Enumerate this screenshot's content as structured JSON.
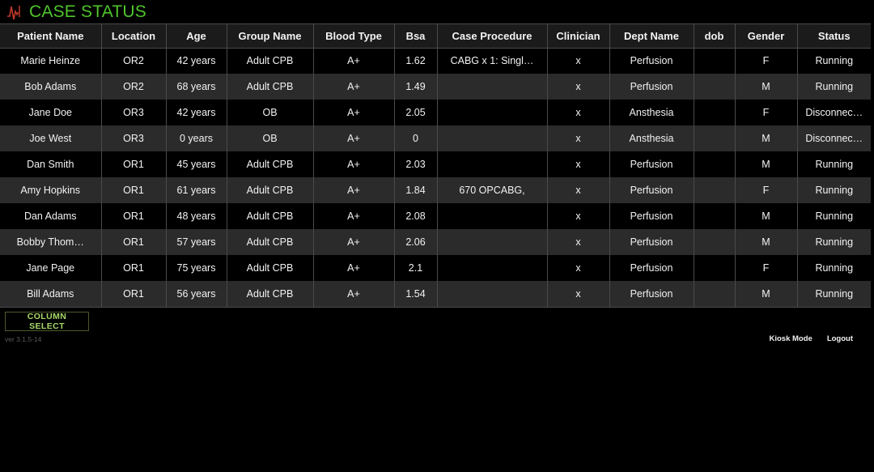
{
  "header": {
    "title": "CASE STATUS",
    "icon": "heartbeat-icon",
    "title_color": "#4fc42c",
    "icon_color": "#c0392b"
  },
  "table": {
    "columns": [
      "Patient Name",
      "Location",
      "Age",
      "Group Name",
      "Blood Type",
      "Bsa",
      "Case Procedure",
      "Clinician",
      "Dept Name",
      "dob",
      "Gender",
      "Status"
    ],
    "rows": [
      {
        "patient_name": "Marie Heinze",
        "location": "OR2",
        "age": "42 years",
        "group_name": "Adult CPB",
        "blood_type": "A+",
        "bsa": "1.62",
        "case_procedure": "CABG x 1: Singl…",
        "clinician": "x",
        "dept_name": "Perfusion",
        "dob": "",
        "gender": "F",
        "status": "Running"
      },
      {
        "patient_name": "Bob Adams",
        "location": "OR2",
        "age": "68 years",
        "group_name": "Adult CPB",
        "blood_type": "A+",
        "bsa": "1.49",
        "case_procedure": "",
        "clinician": "x",
        "dept_name": "Perfusion",
        "dob": "",
        "gender": "M",
        "status": "Running"
      },
      {
        "patient_name": "Jane Doe",
        "location": "OR3",
        "age": "42 years",
        "group_name": "OB",
        "blood_type": "A+",
        "bsa": "2.05",
        "case_procedure": "",
        "clinician": "x",
        "dept_name": "Ansthesia",
        "dob": "",
        "gender": "F",
        "status": "Disconnec…"
      },
      {
        "patient_name": "Joe West",
        "location": "OR3",
        "age": "0 years",
        "group_name": "OB",
        "blood_type": "A+",
        "bsa": "0",
        "case_procedure": "",
        "clinician": "x",
        "dept_name": "Ansthesia",
        "dob": "",
        "gender": "M",
        "status": "Disconnec…"
      },
      {
        "patient_name": "Dan Smith",
        "location": "OR1",
        "age": "45 years",
        "group_name": "Adult CPB",
        "blood_type": "A+",
        "bsa": "2.03",
        "case_procedure": "",
        "clinician": "x",
        "dept_name": "Perfusion",
        "dob": "",
        "gender": "M",
        "status": "Running"
      },
      {
        "patient_name": "Amy Hopkins",
        "location": "OR1",
        "age": "61 years",
        "group_name": "Adult CPB",
        "blood_type": "A+",
        "bsa": "1.84",
        "case_procedure": "670 OPCABG,",
        "clinician": "x",
        "dept_name": "Perfusion",
        "dob": "",
        "gender": "F",
        "status": "Running"
      },
      {
        "patient_name": "Dan Adams",
        "location": "OR1",
        "age": "48 years",
        "group_name": "Adult CPB",
        "blood_type": "A+",
        "bsa": "2.08",
        "case_procedure": "",
        "clinician": "x",
        "dept_name": "Perfusion",
        "dob": "",
        "gender": "M",
        "status": "Running"
      },
      {
        "patient_name": "Bobby Thom…",
        "location": "OR1",
        "age": "57 years",
        "group_name": "Adult CPB",
        "blood_type": "A+",
        "bsa": "2.06",
        "case_procedure": "",
        "clinician": "x",
        "dept_name": "Perfusion",
        "dob": "",
        "gender": "M",
        "status": "Running"
      },
      {
        "patient_name": "Jane Page",
        "location": "OR1",
        "age": "75 years",
        "group_name": "Adult CPB",
        "blood_type": "A+",
        "bsa": "2.1",
        "case_procedure": "",
        "clinician": "x",
        "dept_name": "Perfusion",
        "dob": "",
        "gender": "F",
        "status": "Running"
      },
      {
        "patient_name": "Bill Adams",
        "location": "OR1",
        "age": "56 years",
        "group_name": "Adult CPB",
        "blood_type": "A+",
        "bsa": "1.54",
        "case_procedure": "",
        "clinician": "x",
        "dept_name": "Perfusion",
        "dob": "",
        "gender": "M",
        "status": "Running"
      }
    ]
  },
  "footer": {
    "column_select_label": "COLUMN SELECT",
    "column_select_color": "#a8d86a",
    "version": "ver 3.1.5-14",
    "kiosk_mode_label": "Kiosk Mode",
    "logout_label": "Logout"
  }
}
